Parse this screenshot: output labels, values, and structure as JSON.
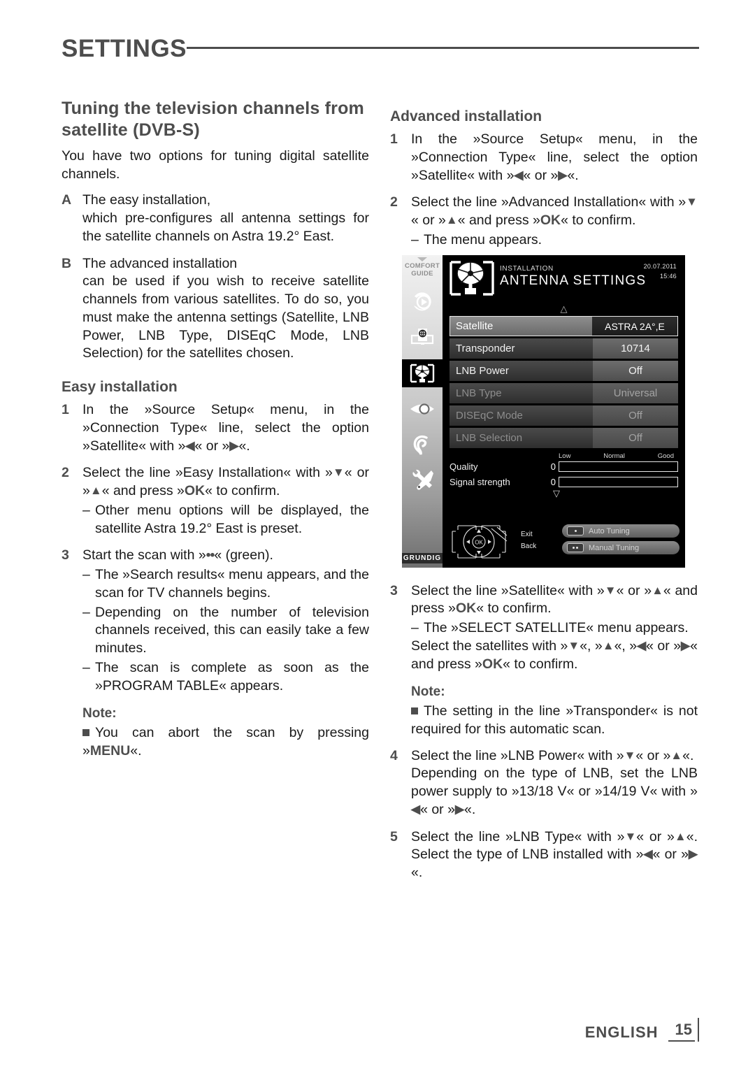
{
  "header": {
    "chapter": "SETTINGS"
  },
  "left": {
    "title": "Tuning the television channels from satellite (DVB-S)",
    "intro": "You have two options for tuning digital satellite channels.",
    "options": [
      {
        "mark": "A",
        "line1": "The easy installation,",
        "line2": "which pre-configures all antenna settings for the satellite channels on Astra 19.2° East."
      },
      {
        "mark": "B",
        "line1": "The advanced installation",
        "line2": "can be used if you wish to receive satellite channels from various satellites. To do so, you must make the antenna settings (Satellite, LNB Power, LNB Type, DISEqC Mode, LNB Selection) for the satellites chosen."
      }
    ],
    "easy_heading": "Easy installation",
    "step1_a": "In the »Source Setup« menu, in the »Connection Type« line, select the option »Satellite« with »",
    "step1_b": "« or »",
    "step1_c": "«.",
    "step2_a": "Select the line »Easy Installation« with »",
    "step2_b": "« or »",
    "step2_c": "« and press »",
    "step2_ok": "OK",
    "step2_d": "« to confirm.",
    "step2_sub": "Other menu options will be displayed, the satellite Astra 19.2° East is preset.",
    "step3_a": "Start the scan with »",
    "step3_dots": "••",
    "step3_b": "« (green).",
    "step3_subs": [
      "The »Search results« menu appears, and the scan for TV channels begins.",
      "Depending on the number of television channels received, this can easily take a few minutes.",
      "The scan is complete as soon as the »PROGRAM TABLE« appears."
    ],
    "note_heading": "Note:",
    "note_a": "You can abort the scan by pressing »",
    "note_key": "MENU",
    "note_b": "«."
  },
  "right": {
    "title": "Advanced installation",
    "step1_a": "In the »Source Setup« menu, in the »Connection Type« line, select the option »Satellite« with »",
    "step1_b": "« or »",
    "step1_c": "«.",
    "step2_a": "Select the line »Advanced Installation« with »",
    "step2_b": "« or »",
    "step2_c": "« and press »",
    "step2_ok": "OK",
    "step2_d": "« to confirm.",
    "step2_sub": "The menu appears.",
    "step3_a": "Select the line »Satellite« with »",
    "step3_b": "« or »",
    "step3_c": "« and press »",
    "step3_ok": "OK",
    "step3_d": "« to confirm.",
    "step3_sub": "The »SELECT SATELLITE« menu appears.",
    "step3_e": "Select the satellites with »",
    "step3_f": "«, »",
    "step3_g": "«, »",
    "step3_h": "« or »",
    "step3_i": "« and press »",
    "step3_ok2": "OK",
    "step3_j": "« to confirm.",
    "note_heading": "Note:",
    "note_text": "The setting in the line »Transponder« is not required for this automatic scan.",
    "step4_a": "Select the line »LNB Power« with »",
    "step4_b": "« or »",
    "step4_c": "«.",
    "step4_d": "Depending on the type of LNB, set the LNB power supply to »13/18 V« or »14/19 V« with »",
    "step4_e": "« or »",
    "step4_f": "«.",
    "step5_a": "Select the line »LNB Type« with »",
    "step5_b": "« or »",
    "step5_c": "«.",
    "step5_d": "Select the type of LNB installed with »",
    "step5_e": "« or »",
    "step5_f": "«."
  },
  "tv": {
    "comfort_guide": "COMFORT GUIDE",
    "brand": "GRUNDIG",
    "breadcrumb": "INSTALLATION",
    "screen_title": "ANTENNA SETTINGS",
    "date": "20.07.2011",
    "time": "15:46",
    "menu_rows": [
      {
        "label": "Satellite",
        "value": "ASTRA 2A°,E",
        "state": "selected"
      },
      {
        "label": "Transponder",
        "value": "10714",
        "state": "normal"
      },
      {
        "label": "LNB Power",
        "value": "Off",
        "state": "normal"
      },
      {
        "label": "LNB Type",
        "value": "Universal",
        "state": "dim"
      },
      {
        "label": "DISEqC Mode",
        "value": "Off",
        "state": "dim"
      },
      {
        "label": "LNB Selection",
        "value": "Off",
        "state": "dim"
      }
    ],
    "scale": {
      "low": "Low",
      "normal": "Normal",
      "good": "Good"
    },
    "meters": [
      {
        "name": "Quality",
        "value": "0"
      },
      {
        "name": "Signal strength",
        "value": "0"
      }
    ],
    "nav": {
      "exit": "Exit",
      "back": "Back",
      "ok": "OK"
    },
    "buttons": [
      {
        "label": "Auto Tuning",
        "dots": 1
      },
      {
        "label": "Manual Tuning",
        "dots": 2
      }
    ]
  },
  "footer": {
    "language": "ENGLISH",
    "page": "15"
  }
}
